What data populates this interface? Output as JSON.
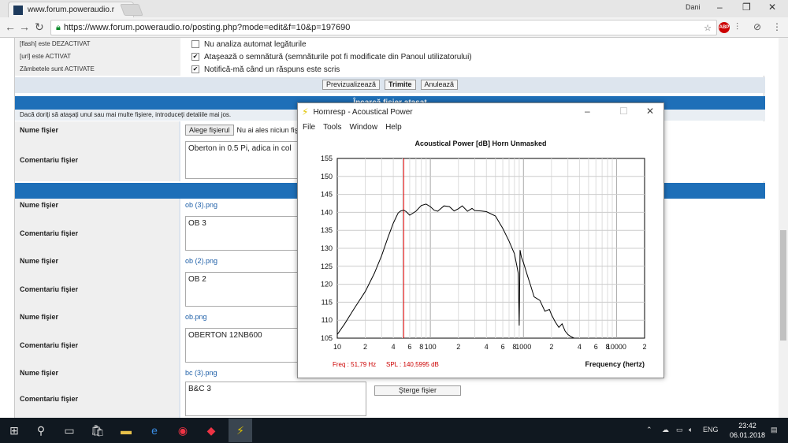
{
  "browser": {
    "tab_title": "www.forum.poweraudio.r",
    "tab_close": "×",
    "user": "Dani",
    "url": "https://www.forum.poweraudio.ro/posting.php?mode=edit&f=10&p=197690",
    "abp_label": "ABP"
  },
  "options": [
    {
      "left": "[flash] este DEZACTIVAT",
      "right": "Nu analiza automat legăturile",
      "checked": false
    },
    {
      "left": "[url] este ACTIVAT",
      "right": "Ataşează o semnătură (semnăturile pot fi modificate din Panoul utilizatorului)",
      "checked": true
    },
    {
      "left": "Zâmbetele sunt ACTIVATE",
      "right": "Notifică-mă când un răspuns este scris",
      "checked": true
    }
  ],
  "buttons": {
    "preview": "Previzualizează",
    "submit": "Trimite",
    "cancel": "Anulează",
    "delete_file": "Şterge fişier"
  },
  "upload": {
    "header": "Încarcă fişier ataşat",
    "info": "Dacă doriţi să ataşaţi unul sau mai multe fişiere, introduceţi detaliile mai jos.",
    "file_label": "Nume fişier",
    "comment_label": "Comentariu fişier",
    "browse": "Alege fişierul",
    "no_file": "Nu ai ales niciun fiş",
    "comment_value": "Oberton in 0.5 Pi, adica in col"
  },
  "attachments": [
    {
      "file": "ob (3).png",
      "comment": "OB 3"
    },
    {
      "file": "ob (2).png",
      "comment": "OB 2"
    },
    {
      "file": "ob.png",
      "comment": "OBERTON 12NB600"
    },
    {
      "file": "bc (3).png",
      "comment": "B&C 3"
    }
  ],
  "hornresp": {
    "title": "Hornresp - Acoustical Power",
    "menu": [
      "File",
      "Tools",
      "Window",
      "Help"
    ],
    "readout_freq": "Freq : 51,79 Hz",
    "readout_spl": "SPL : 140,5995 dB"
  },
  "chart_data": {
    "type": "line",
    "title": "Acoustical Power [dB]   Horn   Unmasked",
    "xlabel": "Frequency (hertz)",
    "ylabel": "",
    "x_scale": "log",
    "xlim": [
      10,
      20000
    ],
    "ylim": [
      105,
      155
    ],
    "x_ticks": [
      "10",
      "2",
      "4",
      "6",
      "8",
      "100",
      "2",
      "4",
      "6",
      "8",
      "1000",
      "2",
      "4",
      "6",
      "8",
      "10000",
      "2"
    ],
    "y_ticks": [
      "105",
      "110",
      "115",
      "120",
      "125",
      "130",
      "135",
      "140",
      "145",
      "150",
      "155"
    ],
    "cursor_x": 51.79,
    "grid": true,
    "series": [
      {
        "x": [
          10,
          12,
          15,
          20,
          25,
          30,
          35,
          40,
          45,
          48,
          51.79,
          55,
          60,
          70,
          80,
          90,
          100,
          110,
          120,
          140,
          160,
          180,
          200,
          220,
          250,
          280,
          300,
          350,
          400,
          500,
          600,
          700,
          800,
          850,
          880,
          900,
          920,
          950,
          1000,
          1100,
          1200,
          1300,
          1500,
          1700,
          1900,
          2000,
          2200,
          2400,
          2600,
          2800,
          3000,
          3200,
          3500
        ],
        "y": [
          106,
          109,
          113,
          118,
          123,
          128,
          133,
          137,
          139.8,
          140.4,
          140.6,
          140.2,
          139.2,
          140.3,
          141.9,
          142.3,
          141.6,
          140.6,
          140.3,
          141.8,
          141.6,
          140.4,
          141.0,
          141.8,
          140.3,
          141.1,
          140.5,
          140.4,
          140.2,
          139.0,
          135.5,
          132.0,
          128.5,
          125.0,
          123.0,
          108.5,
          129.5,
          127.5,
          126.0,
          122.5,
          119.5,
          116.5,
          115.5,
          112.5,
          113.0,
          111.5,
          109.5,
          108.0,
          109.0,
          107.0,
          106.0,
          105.5,
          105.0
        ]
      }
    ]
  },
  "taskbar": {
    "lang": "ENG",
    "time": "23:42",
    "date": "06.01.2018"
  }
}
